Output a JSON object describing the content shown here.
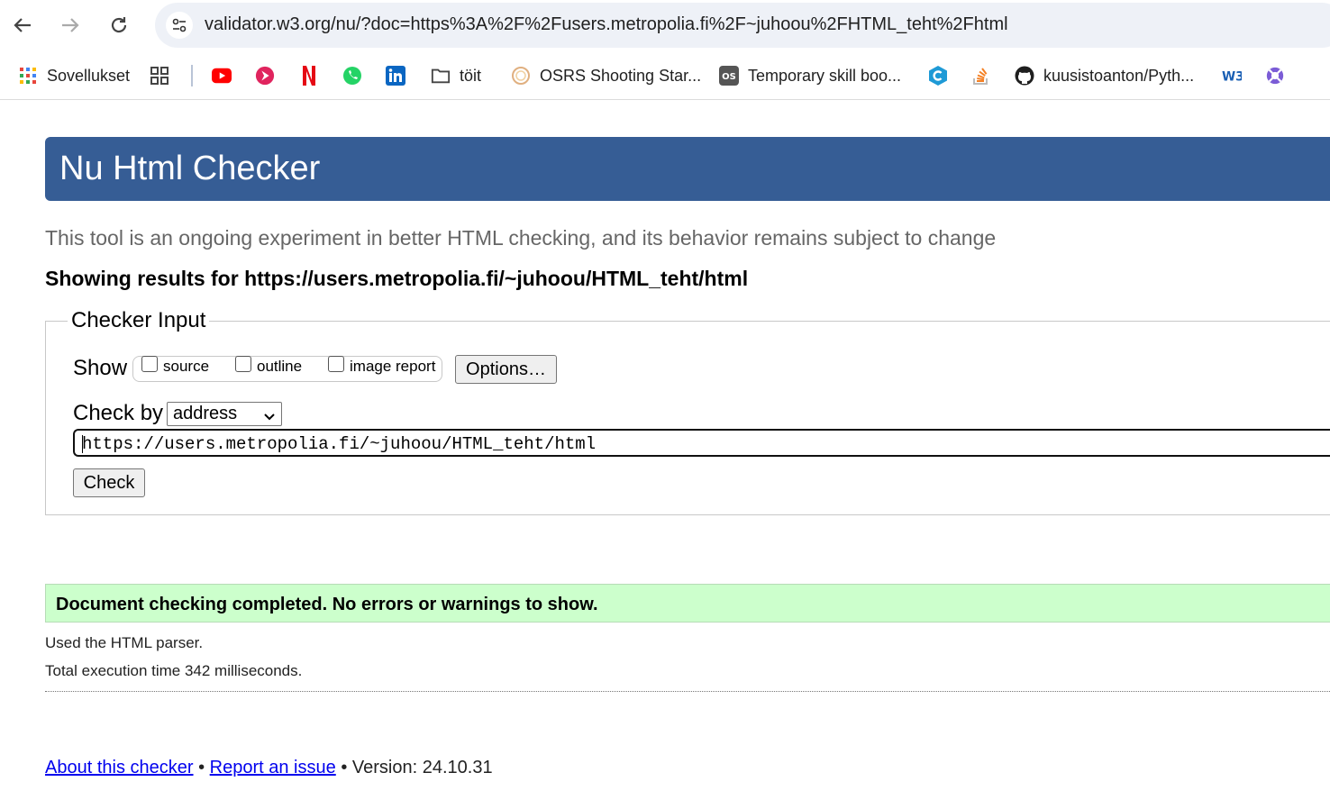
{
  "browser": {
    "url": "validator.w3.org/nu/?doc=https%3A%2F%2Fusers.metropolia.fi%2F~juhoou%2FHTML_teht%2Fhtml",
    "bookmarks": [
      {
        "label": "Sovellukset",
        "icon": "apps-grid-icon"
      },
      {
        "label": "",
        "icon": "tab-groups-icon"
      },
      {
        "label": "",
        "icon": "youtube-icon"
      },
      {
        "label": "",
        "icon": "play-red-icon"
      },
      {
        "label": "",
        "icon": "netflix-icon"
      },
      {
        "label": "",
        "icon": "whatsapp-icon"
      },
      {
        "label": "",
        "icon": "linkedin-icon"
      },
      {
        "label": "töit",
        "icon": "folder-icon"
      },
      {
        "label": "OSRS Shooting Star...",
        "icon": "star-ring-icon"
      },
      {
        "label": "Temporary skill boo...",
        "icon": "os-logo-icon"
      },
      {
        "label": "",
        "icon": "c-hexagon-icon"
      },
      {
        "label": "",
        "icon": "stackoverflow-icon"
      },
      {
        "label": "kuusistoanton/Pyth...",
        "icon": "github-icon"
      },
      {
        "label": "",
        "icon": "w3-icon"
      },
      {
        "label": "",
        "icon": "lifebuoy-icon"
      }
    ]
  },
  "page": {
    "title": "Nu Html Checker",
    "subtitle": "This tool is an ongoing experiment in better HTML checking, and its behavior remains subject to change",
    "results_for": "Showing results for https://users.metropolia.fi/~juhoou/HTML_teht/html"
  },
  "checker": {
    "legend": "Checker Input",
    "show_label": "Show",
    "options": [
      {
        "label": "source",
        "checked": false
      },
      {
        "label": "outline",
        "checked": false
      },
      {
        "label": "image report",
        "checked": false
      }
    ],
    "options_button": "Options…",
    "check_by_label": "Check by",
    "check_by_value": "address",
    "url_value": "https://users.metropolia.fi/~juhoou/HTML_teht/html",
    "check_button": "Check"
  },
  "result": {
    "message": "Document checking completed. No errors or warnings to show.",
    "parser": "Used the HTML parser.",
    "execution_time": "Total execution time 342 milliseconds."
  },
  "footer": {
    "about_link": "About this checker",
    "separator": "•",
    "report_link": "Report an issue",
    "version": "Version: 24.10.31"
  },
  "colors": {
    "header_bg": "#365d95",
    "success_bg": "#ccffcc",
    "link": "#0000ee"
  }
}
